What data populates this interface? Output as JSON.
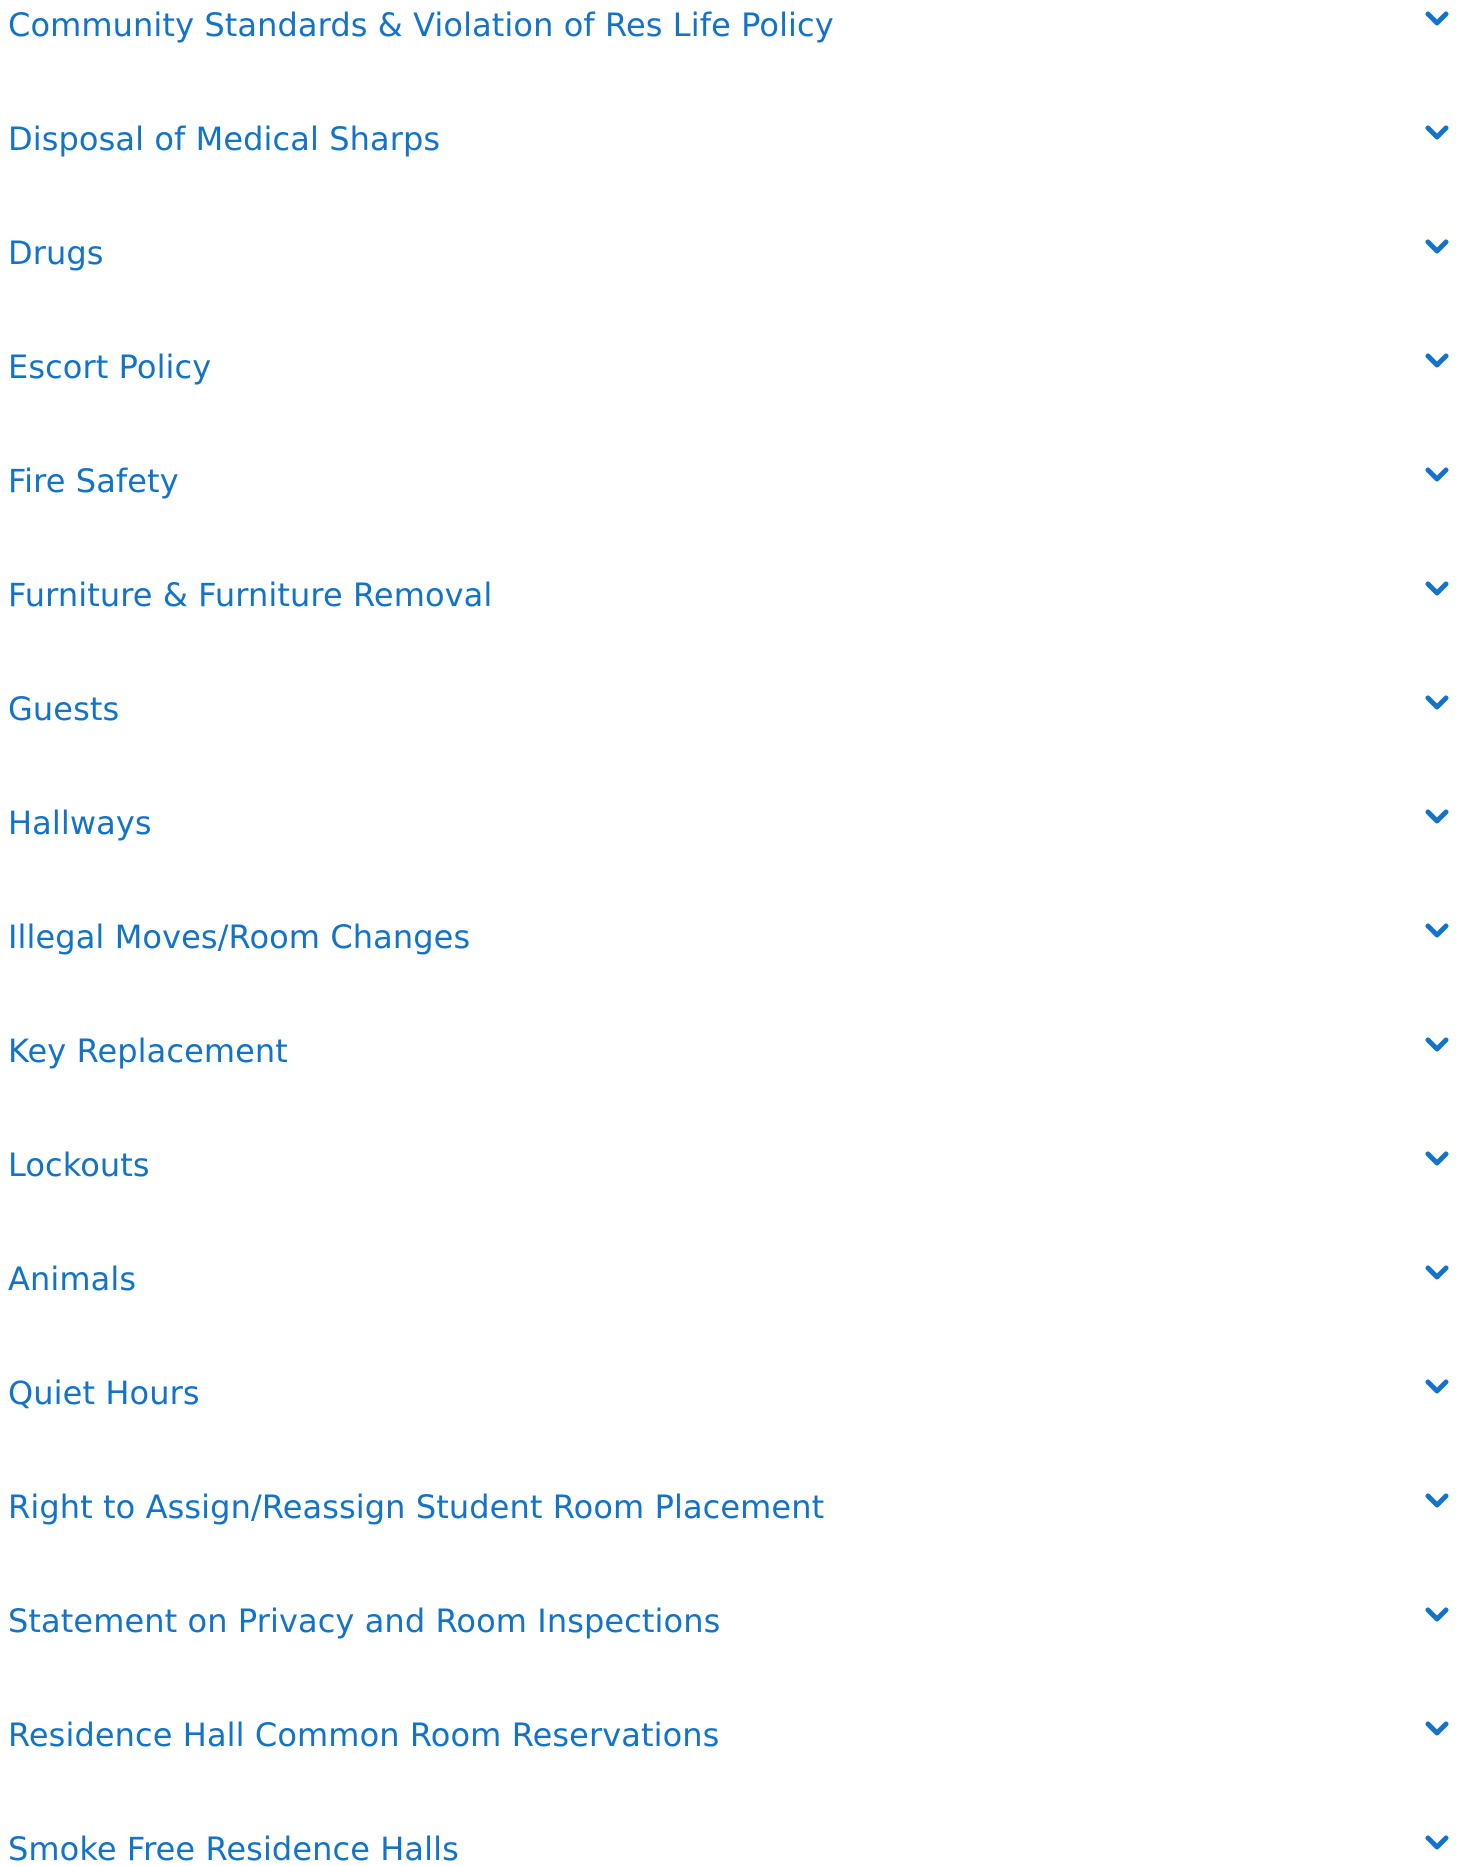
{
  "accordion": {
    "accent_color": "#1273c9",
    "toggle_icon": "chevron-down-icon",
    "items": [
      {
        "label": "Community Standards & Violation of Res Life Policy"
      },
      {
        "label": "Disposal of Medical Sharps"
      },
      {
        "label": "Drugs"
      },
      {
        "label": "Escort Policy"
      },
      {
        "label": "Fire Safety"
      },
      {
        "label": "Furniture & Furniture Removal"
      },
      {
        "label": "Guests"
      },
      {
        "label": "Hallways"
      },
      {
        "label": "Illegal Moves/Room Changes"
      },
      {
        "label": "Key Replacement"
      },
      {
        "label": "Lockouts"
      },
      {
        "label": "Animals"
      },
      {
        "label": "Quiet Hours"
      },
      {
        "label": "Right to Assign/Reassign Student Room Placement"
      },
      {
        "label": "Statement on Privacy and Room Inspections"
      },
      {
        "label": "Residence Hall Common Room Reservations"
      },
      {
        "label": "Smoke Free Residence Halls"
      }
    ]
  }
}
